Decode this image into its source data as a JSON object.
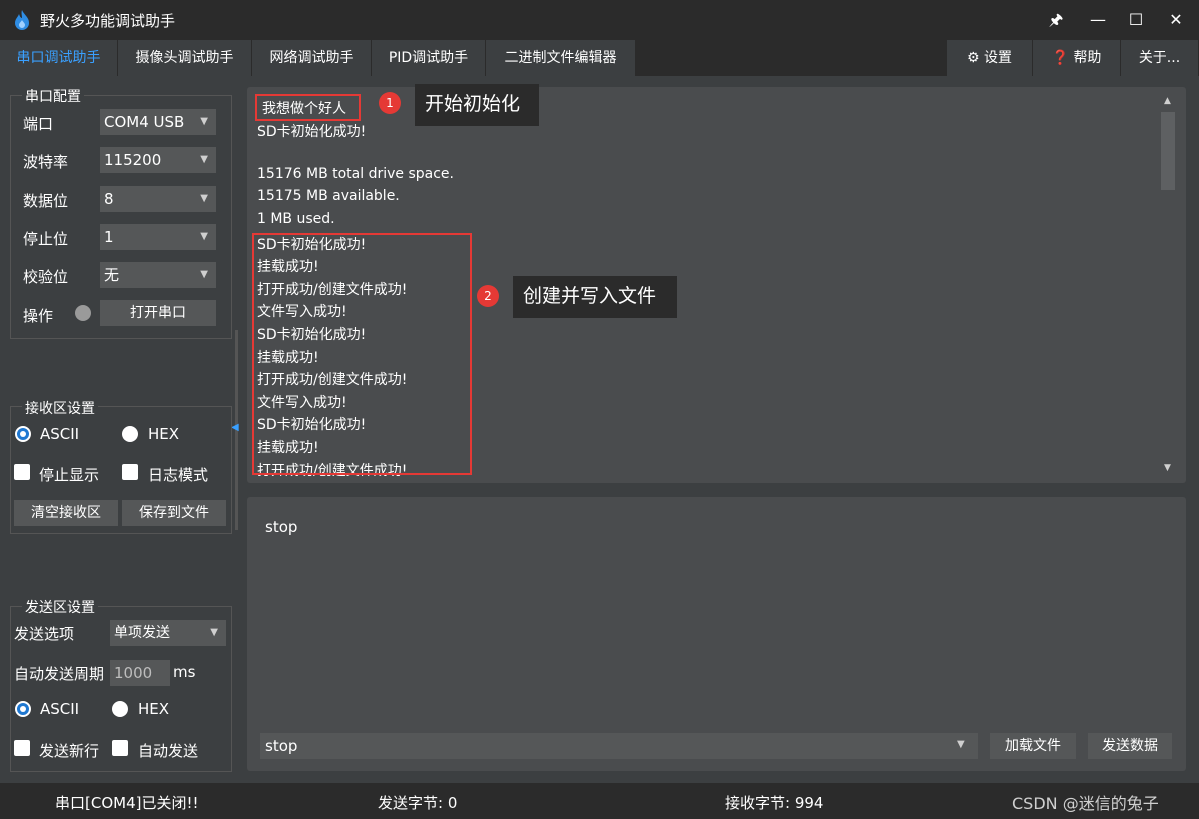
{
  "window": {
    "title": "野火多功能调试助手",
    "pin": "🖈",
    "minimize": "—",
    "maximize": "☐",
    "close": "✕"
  },
  "tabs": [
    "串口调试助手",
    "摄像头调试助手",
    "网络调试助手",
    "PID调试助手",
    "二进制文件编辑器"
  ],
  "top_actions": {
    "settings": "设置",
    "help": "帮助",
    "about": "关于..."
  },
  "serial_config": {
    "title": "串口配置",
    "port_label": "端口",
    "port_value": "COM4 USB",
    "baud_label": "波特率",
    "baud_value": "115200",
    "databits_label": "数据位",
    "databits_value": "8",
    "stopbits_label": "停止位",
    "stopbits_value": "1",
    "parity_label": "校验位",
    "parity_value": "无",
    "action_label": "操作",
    "open_button": "打开串口"
  },
  "receive_settings": {
    "title": "接收区设置",
    "ascii": "ASCII",
    "hex": "HEX",
    "stop_display": "停止显示",
    "log_mode": "日志模式",
    "clear_button": "清空接收区",
    "save_button": "保存到文件"
  },
  "send_settings": {
    "title": "发送区设置",
    "option_label": "发送选项",
    "option_value": "单项发送",
    "period_label": "自动发送周期",
    "period_value": "1000",
    "period_unit": "ms",
    "ascii": "ASCII",
    "hex": "HEX",
    "newline": "发送新行",
    "auto_send": "自动发送"
  },
  "receive_lines": [
    "我想做个好人",
    "SD卡初始化成功!",
    "",
    "15176 MB total drive space.",
    "15175 MB available.",
    "1 MB  used.",
    "SD卡初始化成功!",
    "挂载成功!",
    "打开成功/创建文件成功!",
    "文件写入成功!",
    "SD卡初始化成功!",
    "挂载成功!",
    "打开成功/创建文件成功!",
    "文件写入成功!",
    "SD卡初始化成功!",
    "挂载成功!",
    "打开成功/创建文件成功!"
  ],
  "annotations": [
    {
      "number": "1",
      "text": "开始初始化"
    },
    {
      "number": "2",
      "text": "创建并写入文件"
    }
  ],
  "send": {
    "text": "stop",
    "history_value": "stop",
    "load_button": "加载文件",
    "send_button": "发送数据"
  },
  "status": {
    "port_state": "串口[COM4]已关闭!!",
    "sent_bytes": "发送字节: 0",
    "recv_bytes": "接收字节: 994"
  },
  "watermark": "CSDN @迷信的兔子"
}
